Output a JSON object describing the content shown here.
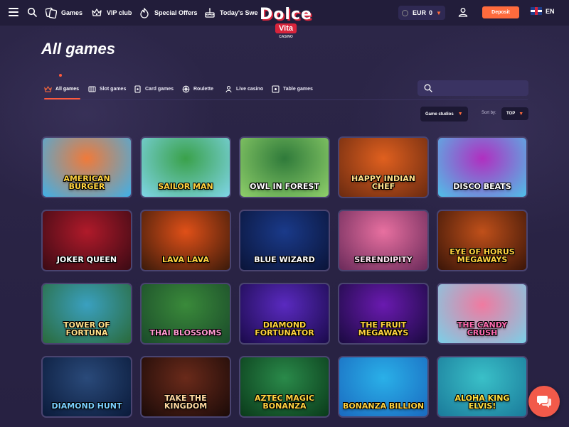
{
  "header": {
    "nav": [
      {
        "label": "Games",
        "icon": "games-icon"
      },
      {
        "label": "VIP club",
        "icon": "vip-icon"
      },
      {
        "label": "Special Offers",
        "icon": "offers-icon"
      },
      {
        "label": "Today's Swe",
        "icon": "cake-icon"
      }
    ],
    "logo": {
      "line1": "Dolce",
      "line2": "Vita",
      "line3": "CASINO"
    },
    "balance": {
      "currency": "EUR",
      "amount": "0"
    },
    "deposit_label": "Deposit",
    "language": "EN"
  },
  "page": {
    "title": "All games",
    "tabs": [
      {
        "label": "All games",
        "icon": "all-games-icon",
        "active": true
      },
      {
        "label": "Slot games",
        "icon": "slot-icon",
        "active": false
      },
      {
        "label": "Card games",
        "icon": "card-icon",
        "active": false
      },
      {
        "label": "Roulette",
        "icon": "roulette-icon",
        "active": false
      },
      {
        "label": "Live casino",
        "icon": "live-icon",
        "active": false
      },
      {
        "label": "Table games",
        "icon": "table-icon",
        "active": false
      }
    ],
    "search": {
      "placeholder": ""
    },
    "filters": {
      "studios_label": "Game studios",
      "sort_label": "Sort by:",
      "sort_value": "TOP"
    }
  },
  "games": [
    {
      "name": "American Burger",
      "bg": "#f07a3a",
      "bg2": "#3fb0e8",
      "color": "#ffd23f"
    },
    {
      "name": "Sailor Man",
      "bg": "#3aa14a",
      "bg2": "#7fd5e8",
      "color": "#ffd23f"
    },
    {
      "name": "Owl in Forest",
      "bg": "#2f7a3a",
      "bg2": "#8fcf6a",
      "color": "#ffffff"
    },
    {
      "name": "Happy Indian Chef",
      "bg": "#e0601f",
      "bg2": "#6a2a10",
      "color": "#ffe08a"
    },
    {
      "name": "Disco Beats",
      "bg": "#b02fc0",
      "bg2": "#4fc0e8",
      "color": "#ffffff"
    },
    {
      "name": "Joker Queen",
      "bg": "#b01a2a",
      "bg2": "#3a0a14",
      "color": "#ffffff"
    },
    {
      "name": "Lava Lava",
      "bg": "#e05018",
      "bg2": "#3a1a0a",
      "color": "#ffd23f"
    },
    {
      "name": "Blue Wizard",
      "bg": "#1a3a8a",
      "bg2": "#0a1438",
      "color": "#ffffff"
    },
    {
      "name": "Serendipity",
      "bg": "#e870a0",
      "bg2": "#6a2a5a",
      "color": "#ffe0f0"
    },
    {
      "name": "Eye of Horus Megaways",
      "bg": "#c0501a",
      "bg2": "#3a1508",
      "color": "#ffd23f"
    },
    {
      "name": "Tower of Fortuna",
      "bg": "#3aa0c0",
      "bg2": "#2a6a3a",
      "color": "#ffe08a"
    },
    {
      "name": "Thai Blossoms",
      "bg": "#3a8a3a",
      "bg2": "#1a4a2a",
      "color": "#ff9ad0"
    },
    {
      "name": "Diamond Fortunator",
      "bg": "#5a2ac0",
      "bg2": "#1a0a4a",
      "color": "#ffd23f"
    },
    {
      "name": "The Fruit Megaways",
      "bg": "#6a1ab0",
      "bg2": "#1a0a40",
      "color": "#ffd23f"
    },
    {
      "name": "The Candy Crush",
      "bg": "#f07aa0",
      "bg2": "#7ad0e8",
      "color": "#ff6ab0"
    },
    {
      "name": "Diamond Hunt",
      "bg": "#2a4a7a",
      "bg2": "#0a1a3a",
      "color": "#7ad0ff"
    },
    {
      "name": "Take the Kingdom",
      "bg": "#6a2a1a",
      "bg2": "#1a0a08",
      "color": "#ffd8a0"
    },
    {
      "name": "Aztec Magic Bonanza",
      "bg": "#2a8a4a",
      "bg2": "#0a3a1a",
      "color": "#ffd23f"
    },
    {
      "name": "Bonanza Billion",
      "bg": "#2ab0e8",
      "bg2": "#1a6ac0",
      "color": "#ffd23f"
    },
    {
      "name": "Aloha King Elvis!",
      "bg": "#3ac0c8",
      "bg2": "#1a7a9a",
      "color": "#ffe040"
    }
  ]
}
